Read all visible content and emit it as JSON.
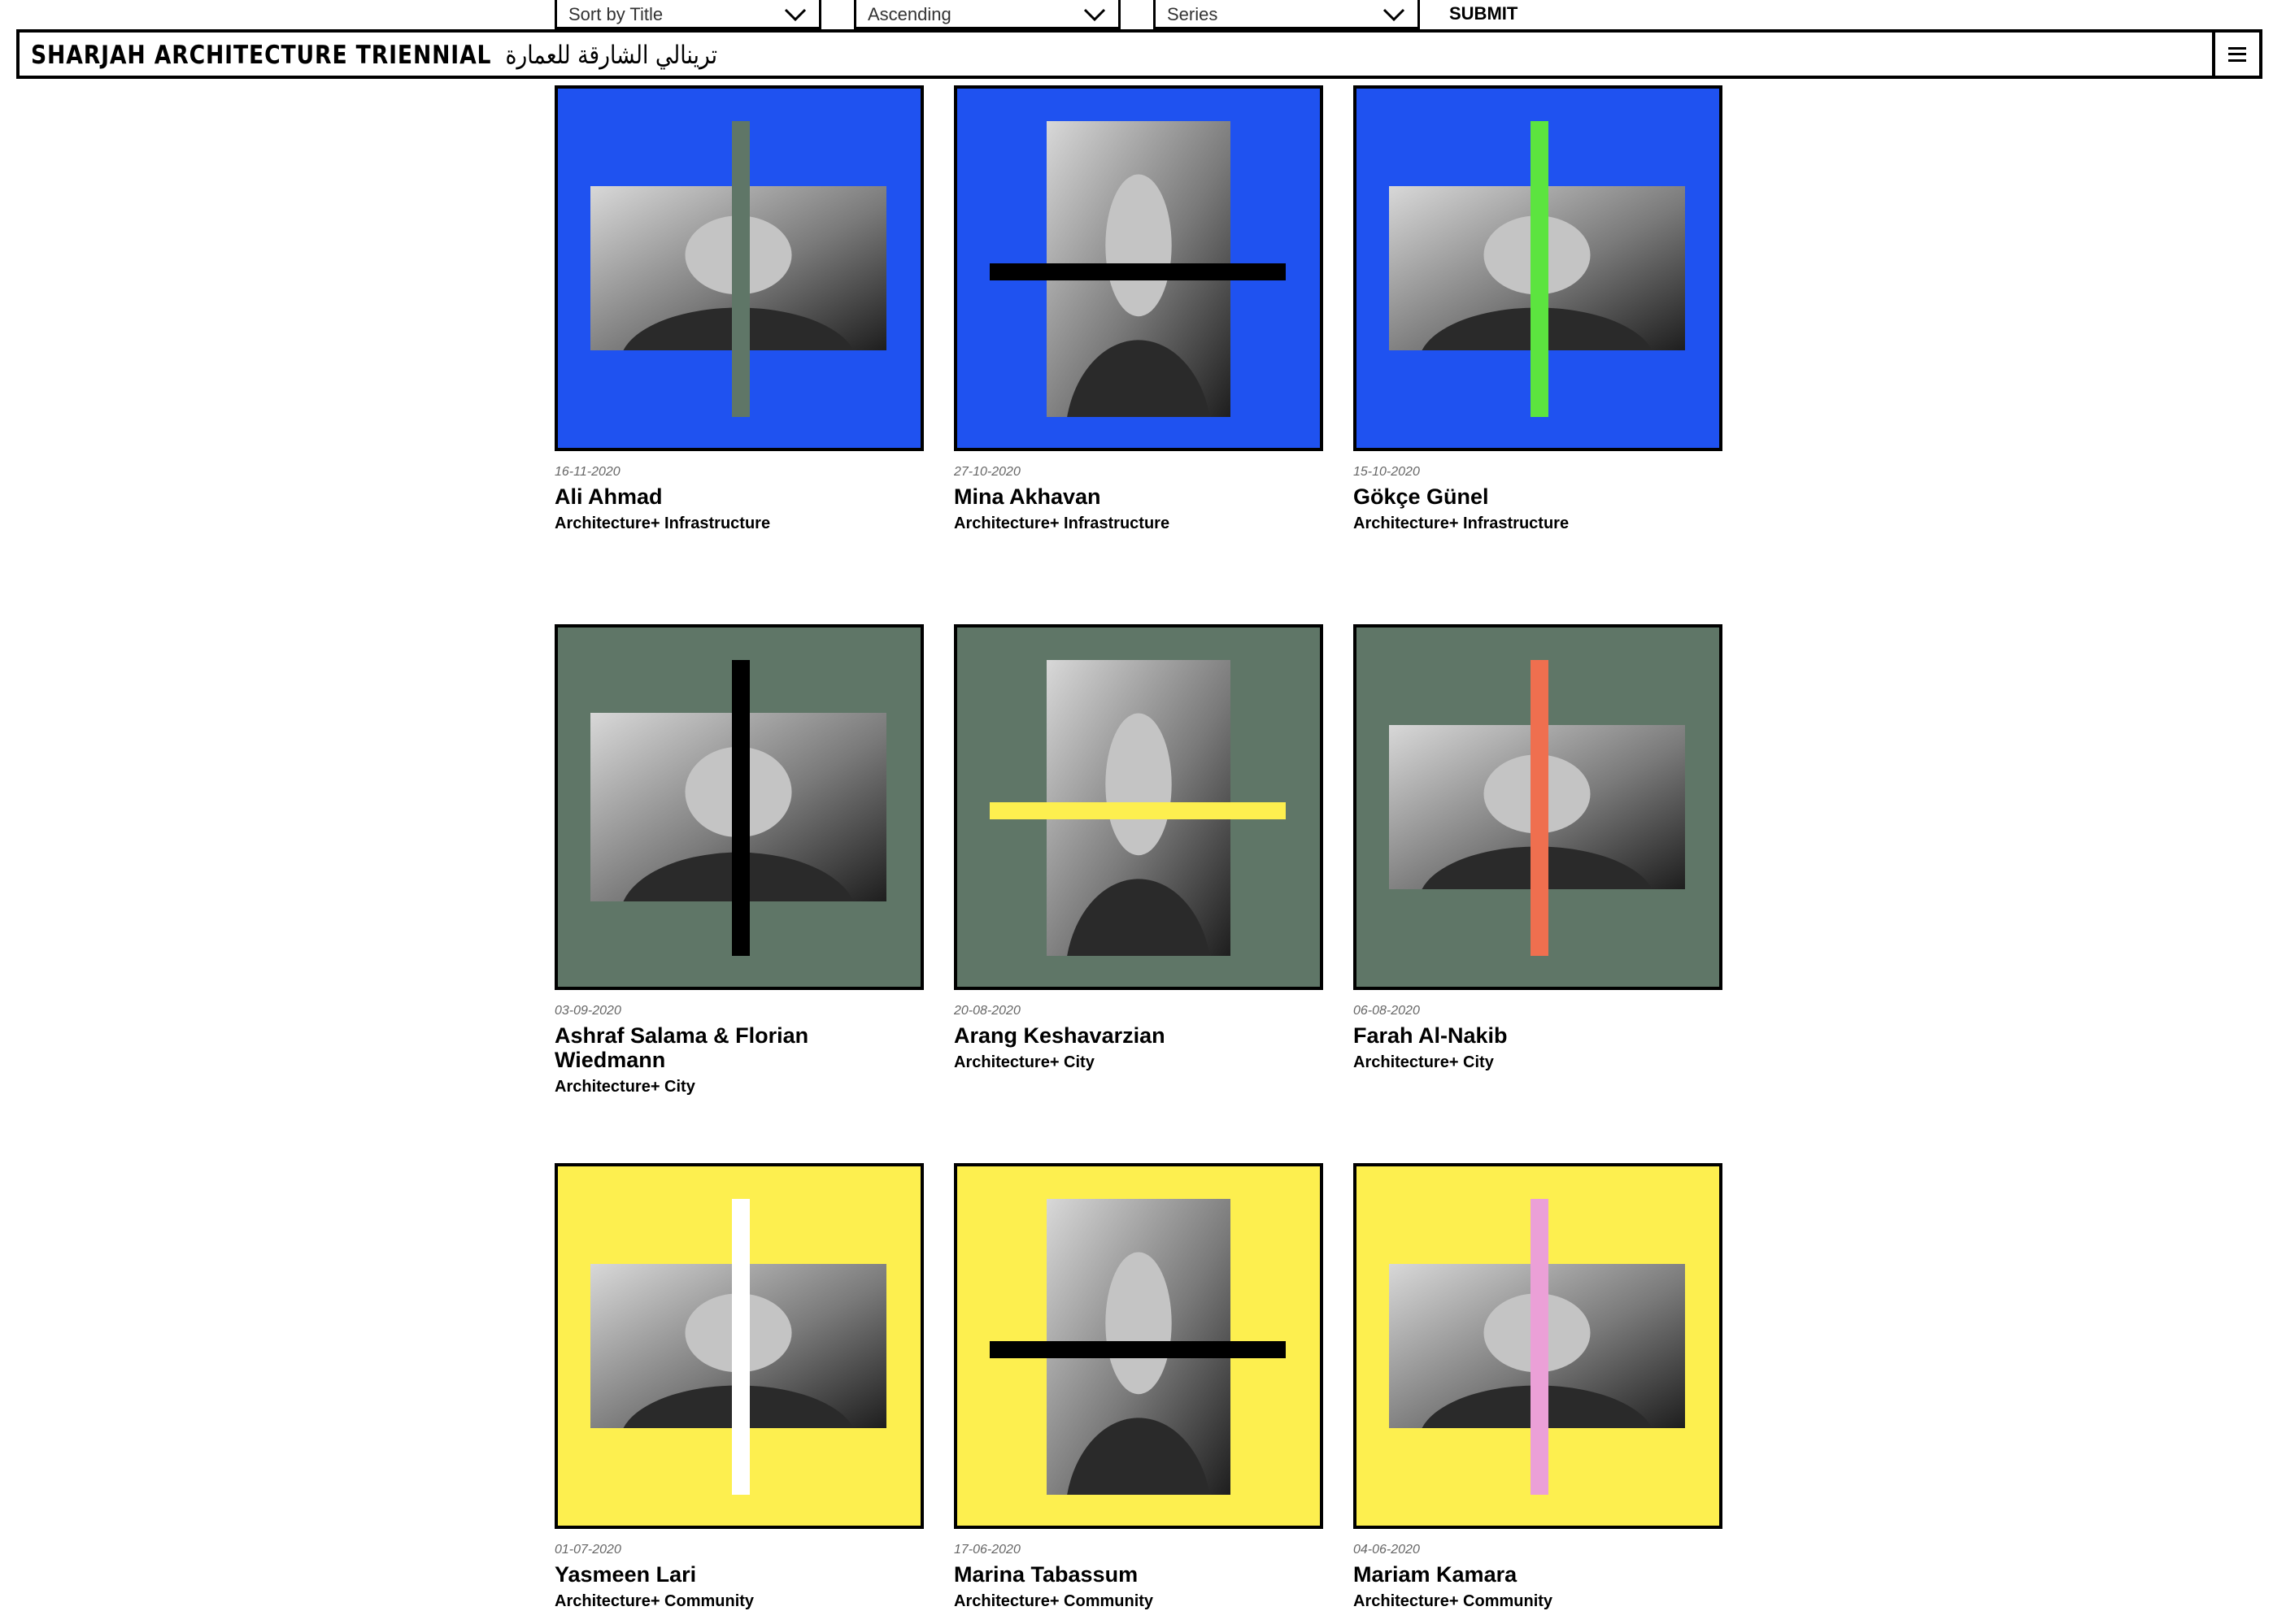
{
  "filters": {
    "sort": {
      "value": "Sort by Title"
    },
    "order": {
      "value": "Ascending"
    },
    "series": {
      "value": "Series"
    },
    "submit_label": "SUBMIT"
  },
  "header": {
    "logo_en": "SHARJAH ARCHITECTURE TRIENNIAL",
    "logo_ar": "ترينالي الشارقة للعمارة",
    "menu_icon": "hamburger-icon"
  },
  "colors": {
    "blue": "#1f52f0",
    "green_gray": "#5f7667",
    "yellow": "#fdef4f",
    "lime": "#5ce43f",
    "coral": "#ef6f4f",
    "pink": "#eba0d7",
    "black": "#000000",
    "white": "#ffffff"
  },
  "cards": [
    {
      "date": "16-11-2020",
      "name": "Ali Ahmad",
      "series": "Architecture+ Infrastructure",
      "background": "#1f52f0",
      "stripe_color": "#5f7667",
      "stripe": "vertical",
      "photo": "landscape"
    },
    {
      "date": "27-10-2020",
      "name": "Mina Akhavan",
      "series": "Architecture+ Infrastructure",
      "background": "#1f52f0",
      "stripe_color": "#000000",
      "stripe": "horizontal",
      "photo": "portrait"
    },
    {
      "date": "15-10-2020",
      "name": "Gökçe Günel",
      "series": "Architecture+ Infrastructure",
      "background": "#1f52f0",
      "stripe_color": "#5ce43f",
      "stripe": "vertical",
      "photo": "landscape"
    },
    {
      "date": "03-09-2020",
      "name": "Ashraf Salama & Florian Wiedmann",
      "series": "Architecture+ City",
      "background": "#5f7667",
      "stripe_color": "#000000",
      "stripe": "vertical",
      "photo": "landscape-tall"
    },
    {
      "date": "20-08-2020",
      "name": "Arang Keshavarzian",
      "series": "Architecture+ City",
      "background": "#5f7667",
      "stripe_color": "#fdef4f",
      "stripe": "horizontal",
      "photo": "portrait"
    },
    {
      "date": "06-08-2020",
      "name": "Farah Al-Nakib",
      "series": "Architecture+ City",
      "background": "#5f7667",
      "stripe_color": "#ef6f4f",
      "stripe": "vertical",
      "photo": "landscape"
    },
    {
      "date": "01-07-2020",
      "name": "Yasmeen Lari",
      "series": "Architecture+ Community",
      "background": "#fdef4f",
      "stripe_color": "#ffffff",
      "stripe": "vertical",
      "photo": "landscape"
    },
    {
      "date": "17-06-2020",
      "name": "Marina Tabassum",
      "series": "Architecture+ Community",
      "background": "#fdef4f",
      "stripe_color": "#000000",
      "stripe": "horizontal",
      "photo": "portrait"
    },
    {
      "date": "04-06-2020",
      "name": "Mariam Kamara",
      "series": "Architecture+ Community",
      "background": "#fdef4f",
      "stripe_color": "#eba0d7",
      "stripe": "vertical",
      "photo": "landscape"
    }
  ]
}
